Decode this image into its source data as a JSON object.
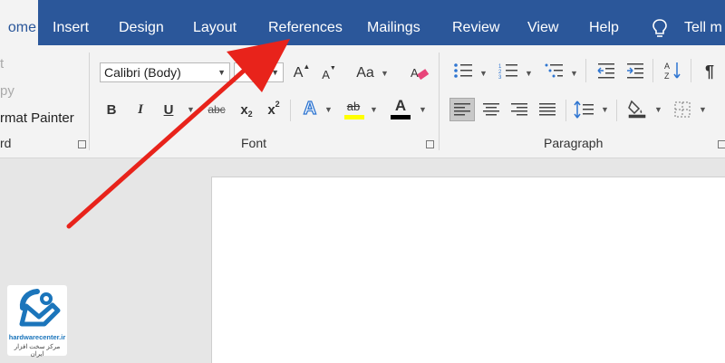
{
  "tabs": [
    "ome",
    "Insert",
    "Design",
    "Layout",
    "References",
    "Mailings",
    "Review",
    "View",
    "Help"
  ],
  "tell_me": "Tell m",
  "clipboard": {
    "cut_label": "t",
    "copy_label": "py",
    "format_painter_label": "rmat Painter",
    "group_label": "rd"
  },
  "font": {
    "font_name": "Calibri (Body)",
    "grow": "A",
    "shrink": "A",
    "change_case": "Aa",
    "bold": "B",
    "italic": "I",
    "underline": "U",
    "strike": "abc",
    "subscript": "x",
    "subscript_mark": "2",
    "superscript": "x",
    "superscript_mark": "2",
    "text_effects": "A",
    "highlight": "ab",
    "font_color": "A",
    "group_label": "Font"
  },
  "paragraph": {
    "group_label": "Paragraph",
    "pilcrow": "¶"
  },
  "watermark": {
    "site": "hardwarecenter.ir",
    "tagline": "مرکز سخت افزار ایران"
  },
  "colors": {
    "ribbon_blue": "#2b579a",
    "arrow_red": "#e8231b",
    "highlight_yellow": "#ffff00",
    "font_color_black": "#000000",
    "logo_blue": "#1b75bb"
  }
}
